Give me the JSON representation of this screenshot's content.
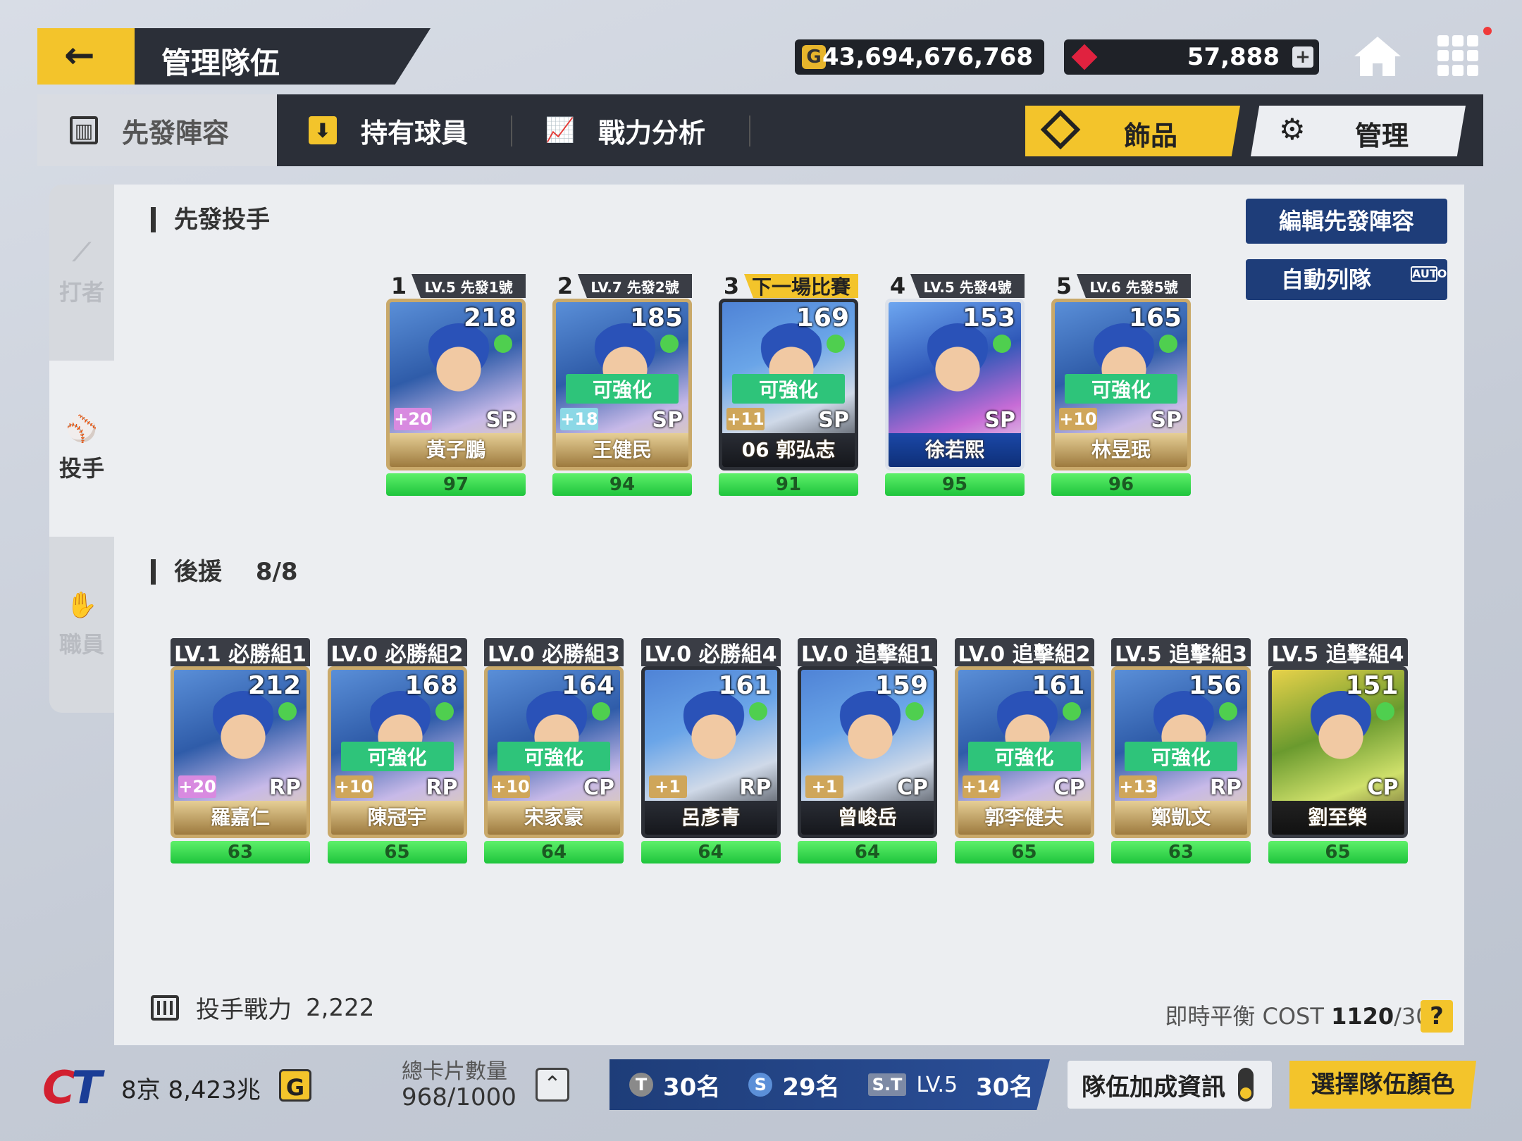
{
  "header": {
    "back_icon": "back-arrow-icon",
    "title": "管理隊伍",
    "gold": "43,694,676,768",
    "gems": "57,888",
    "gold_icon_text": "G"
  },
  "tabs": {
    "starting": "先發陣容",
    "owned": "持有球員",
    "analysis": "戰力分析",
    "decor": "飾品",
    "manage": "管理"
  },
  "side": {
    "batter": "打者",
    "pitcher": "投手",
    "staff": "職員"
  },
  "section": {
    "starters_title": "先發投手",
    "relief_title": "後援",
    "relief_count": "8/8",
    "edit_button": "編輯先發陣容",
    "auto_button": "自動列隊",
    "auto_badge": "AUTO"
  },
  "starters": [
    {
      "slot": "1",
      "label": "LV.5 先發1號",
      "ovr": "218",
      "plus": "+20",
      "pos": "SP",
      "name": "黃子鵬",
      "cond": "97",
      "enh": ""
    },
    {
      "slot": "2",
      "label": "LV.7 先發2號",
      "ovr": "185",
      "plus": "+18",
      "pos": "SP",
      "name": "王健民",
      "cond": "94",
      "enh": "可強化"
    },
    {
      "slot": "3",
      "label": "下一場比賽",
      "ovr": "169",
      "plus": "+11",
      "pos": "SP",
      "name": "06 郭弘志",
      "cond": "91",
      "enh": "可強化"
    },
    {
      "slot": "4",
      "label": "LV.5 先發4號",
      "ovr": "153",
      "plus": "",
      "pos": "SP",
      "name": "徐若熙",
      "cond": "95",
      "enh": ""
    },
    {
      "slot": "5",
      "label": "LV.6 先發5號",
      "ovr": "165",
      "plus": "+10",
      "pos": "SP",
      "name": "林昱珉",
      "cond": "96",
      "enh": "可強化"
    }
  ],
  "relievers": [
    {
      "label": "LV.1 必勝組1",
      "ovr": "212",
      "plus": "+20",
      "pos": "RP",
      "name": "羅嘉仁",
      "cond": "63",
      "enh": ""
    },
    {
      "label": "LV.0 必勝組2",
      "ovr": "168",
      "plus": "+10",
      "pos": "RP",
      "name": "陳冠宇",
      "cond": "65",
      "enh": "可強化"
    },
    {
      "label": "LV.0 必勝組3",
      "ovr": "164",
      "plus": "+10",
      "pos": "CP",
      "name": "宋家豪",
      "cond": "64",
      "enh": "可強化"
    },
    {
      "label": "LV.0 必勝組4",
      "ovr": "161",
      "plus": "+1",
      "pos": "RP",
      "name": "呂彥青",
      "cond": "64",
      "enh": ""
    },
    {
      "label": "LV.0 追擊組1",
      "ovr": "159",
      "plus": "+1",
      "pos": "CP",
      "name": "曾峻岳",
      "cond": "64",
      "enh": ""
    },
    {
      "label": "LV.0 追擊組2",
      "ovr": "161",
      "plus": "+14",
      "pos": "CP",
      "name": "郭李健夫",
      "cond": "65",
      "enh": "可強化"
    },
    {
      "label": "LV.5 追擊組3",
      "ovr": "156",
      "plus": "+13",
      "pos": "RP",
      "name": "鄭凱文",
      "cond": "63",
      "enh": "可強化"
    },
    {
      "label": "LV.5 追擊組4",
      "ovr": "151",
      "plus": "",
      "pos": "CP",
      "name": "劉至榮",
      "cond": "65",
      "enh": ""
    }
  ],
  "footer": {
    "power_label": "投手戰力",
    "power_value": "2,222",
    "cost_label": "即時平衡 COST",
    "cost_value": "1120",
    "cost_max": "/300",
    "help": "?"
  },
  "bottom": {
    "logo_c": "C",
    "logo_t": "T",
    "money": "8京 8,423兆",
    "g_badge": "G",
    "card_count_label": "總卡片數量",
    "card_count_value": "968/1000",
    "rank_t": "30名",
    "rank_s": "29名",
    "rank_st_label": "S.T",
    "rank_st_lv": "LV.5",
    "rank_st": "30名",
    "team_bonus": "隊伍加成資訊",
    "team_color": "選擇隊伍顏色"
  }
}
